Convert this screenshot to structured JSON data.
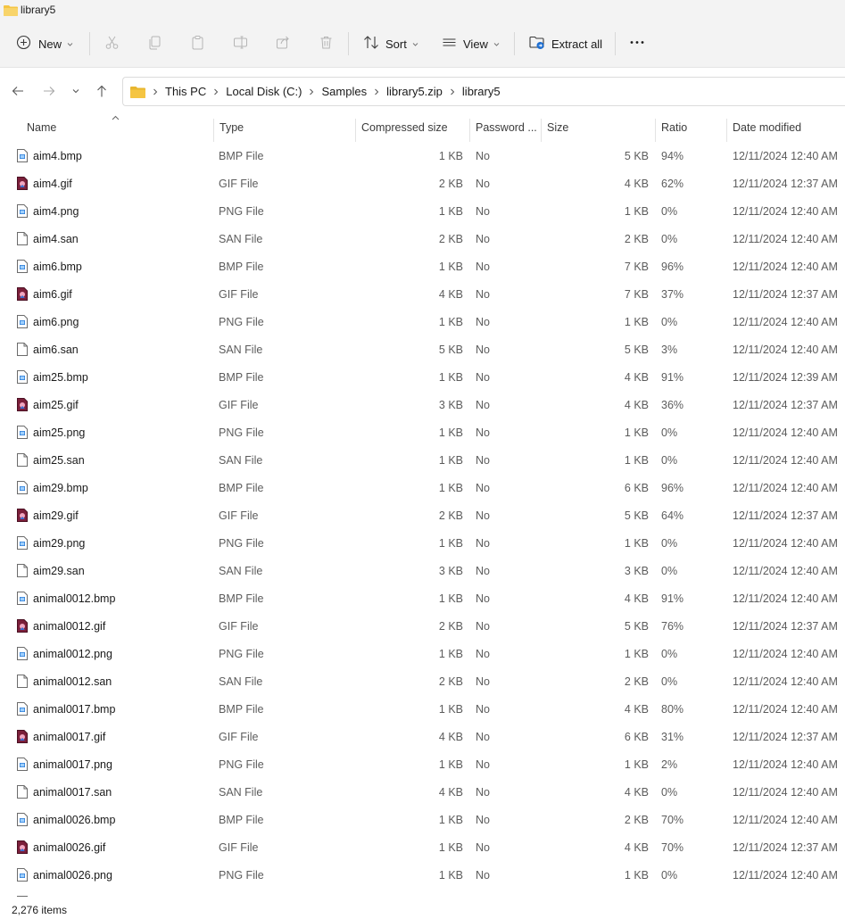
{
  "window": {
    "title": "library5"
  },
  "toolbar": {
    "new_label": "New",
    "sort_label": "Sort",
    "view_label": "View",
    "extract_label": "Extract all",
    "more_icon": "ellipsis-icon"
  },
  "breadcrumb": [
    "This PC",
    "Local Disk (C:)",
    "Samples",
    "library5.zip",
    "library5"
  ],
  "columns": {
    "name": "Name",
    "type": "Type",
    "compressed": "Compressed size",
    "password": "Password ...",
    "size": "Size",
    "ratio": "Ratio",
    "date": "Date modified"
  },
  "files": [
    {
      "name": "aim4.bmp",
      "type": "BMP File",
      "compressed": "1 KB",
      "password": "No",
      "size": "5 KB",
      "ratio": "94%",
      "date": "12/11/2024 12:40 AM",
      "kind": "img"
    },
    {
      "name": "aim4.gif",
      "type": "GIF File",
      "compressed": "2 KB",
      "password": "No",
      "size": "4 KB",
      "ratio": "62%",
      "date": "12/11/2024 12:37 AM",
      "kind": "gif"
    },
    {
      "name": "aim4.png",
      "type": "PNG File",
      "compressed": "1 KB",
      "password": "No",
      "size": "1 KB",
      "ratio": "0%",
      "date": "12/11/2024 12:40 AM",
      "kind": "img"
    },
    {
      "name": "aim4.san",
      "type": "SAN File",
      "compressed": "2 KB",
      "password": "No",
      "size": "2 KB",
      "ratio": "0%",
      "date": "12/11/2024 12:40 AM",
      "kind": "blank"
    },
    {
      "name": "aim6.bmp",
      "type": "BMP File",
      "compressed": "1 KB",
      "password": "No",
      "size": "7 KB",
      "ratio": "96%",
      "date": "12/11/2024 12:40 AM",
      "kind": "img"
    },
    {
      "name": "aim6.gif",
      "type": "GIF File",
      "compressed": "4 KB",
      "password": "No",
      "size": "7 KB",
      "ratio": "37%",
      "date": "12/11/2024 12:37 AM",
      "kind": "gif"
    },
    {
      "name": "aim6.png",
      "type": "PNG File",
      "compressed": "1 KB",
      "password": "No",
      "size": "1 KB",
      "ratio": "0%",
      "date": "12/11/2024 12:40 AM",
      "kind": "img"
    },
    {
      "name": "aim6.san",
      "type": "SAN File",
      "compressed": "5 KB",
      "password": "No",
      "size": "5 KB",
      "ratio": "3%",
      "date": "12/11/2024 12:40 AM",
      "kind": "blank"
    },
    {
      "name": "aim25.bmp",
      "type": "BMP File",
      "compressed": "1 KB",
      "password": "No",
      "size": "4 KB",
      "ratio": "91%",
      "date": "12/11/2024 12:39 AM",
      "kind": "img"
    },
    {
      "name": "aim25.gif",
      "type": "GIF File",
      "compressed": "3 KB",
      "password": "No",
      "size": "4 KB",
      "ratio": "36%",
      "date": "12/11/2024 12:37 AM",
      "kind": "gif"
    },
    {
      "name": "aim25.png",
      "type": "PNG File",
      "compressed": "1 KB",
      "password": "No",
      "size": "1 KB",
      "ratio": "0%",
      "date": "12/11/2024 12:40 AM",
      "kind": "img"
    },
    {
      "name": "aim25.san",
      "type": "SAN File",
      "compressed": "1 KB",
      "password": "No",
      "size": "1 KB",
      "ratio": "0%",
      "date": "12/11/2024 12:40 AM",
      "kind": "blank"
    },
    {
      "name": "aim29.bmp",
      "type": "BMP File",
      "compressed": "1 KB",
      "password": "No",
      "size": "6 KB",
      "ratio": "96%",
      "date": "12/11/2024 12:40 AM",
      "kind": "img"
    },
    {
      "name": "aim29.gif",
      "type": "GIF File",
      "compressed": "2 KB",
      "password": "No",
      "size": "5 KB",
      "ratio": "64%",
      "date": "12/11/2024 12:37 AM",
      "kind": "gif"
    },
    {
      "name": "aim29.png",
      "type": "PNG File",
      "compressed": "1 KB",
      "password": "No",
      "size": "1 KB",
      "ratio": "0%",
      "date": "12/11/2024 12:40 AM",
      "kind": "img"
    },
    {
      "name": "aim29.san",
      "type": "SAN File",
      "compressed": "3 KB",
      "password": "No",
      "size": "3 KB",
      "ratio": "0%",
      "date": "12/11/2024 12:40 AM",
      "kind": "blank"
    },
    {
      "name": "animal0012.bmp",
      "type": "BMP File",
      "compressed": "1 KB",
      "password": "No",
      "size": "4 KB",
      "ratio": "91%",
      "date": "12/11/2024 12:40 AM",
      "kind": "img"
    },
    {
      "name": "animal0012.gif",
      "type": "GIF File",
      "compressed": "2 KB",
      "password": "No",
      "size": "5 KB",
      "ratio": "76%",
      "date": "12/11/2024 12:37 AM",
      "kind": "gif"
    },
    {
      "name": "animal0012.png",
      "type": "PNG File",
      "compressed": "1 KB",
      "password": "No",
      "size": "1 KB",
      "ratio": "0%",
      "date": "12/11/2024 12:40 AM",
      "kind": "img"
    },
    {
      "name": "animal0012.san",
      "type": "SAN File",
      "compressed": "2 KB",
      "password": "No",
      "size": "2 KB",
      "ratio": "0%",
      "date": "12/11/2024 12:40 AM",
      "kind": "blank"
    },
    {
      "name": "animal0017.bmp",
      "type": "BMP File",
      "compressed": "1 KB",
      "password": "No",
      "size": "4 KB",
      "ratio": "80%",
      "date": "12/11/2024 12:40 AM",
      "kind": "img"
    },
    {
      "name": "animal0017.gif",
      "type": "GIF File",
      "compressed": "4 KB",
      "password": "No",
      "size": "6 KB",
      "ratio": "31%",
      "date": "12/11/2024 12:37 AM",
      "kind": "gif"
    },
    {
      "name": "animal0017.png",
      "type": "PNG File",
      "compressed": "1 KB",
      "password": "No",
      "size": "1 KB",
      "ratio": "2%",
      "date": "12/11/2024 12:40 AM",
      "kind": "img"
    },
    {
      "name": "animal0017.san",
      "type": "SAN File",
      "compressed": "4 KB",
      "password": "No",
      "size": "4 KB",
      "ratio": "0%",
      "date": "12/11/2024 12:40 AM",
      "kind": "blank"
    },
    {
      "name": "animal0026.bmp",
      "type": "BMP File",
      "compressed": "1 KB",
      "password": "No",
      "size": "2 KB",
      "ratio": "70%",
      "date": "12/11/2024 12:40 AM",
      "kind": "img"
    },
    {
      "name": "animal0026.gif",
      "type": "GIF File",
      "compressed": "1 KB",
      "password": "No",
      "size": "4 KB",
      "ratio": "70%",
      "date": "12/11/2024 12:37 AM",
      "kind": "gif"
    },
    {
      "name": "animal0026.png",
      "type": "PNG File",
      "compressed": "1 KB",
      "password": "No",
      "size": "1 KB",
      "ratio": "0%",
      "date": "12/11/2024 12:40 AM",
      "kind": "img"
    }
  ],
  "status": {
    "item_count": "2,276 items"
  },
  "colors": {
    "folder": "#f5c542",
    "accent": "#1f6fd1",
    "gif_icon": "#7b1f3a"
  }
}
